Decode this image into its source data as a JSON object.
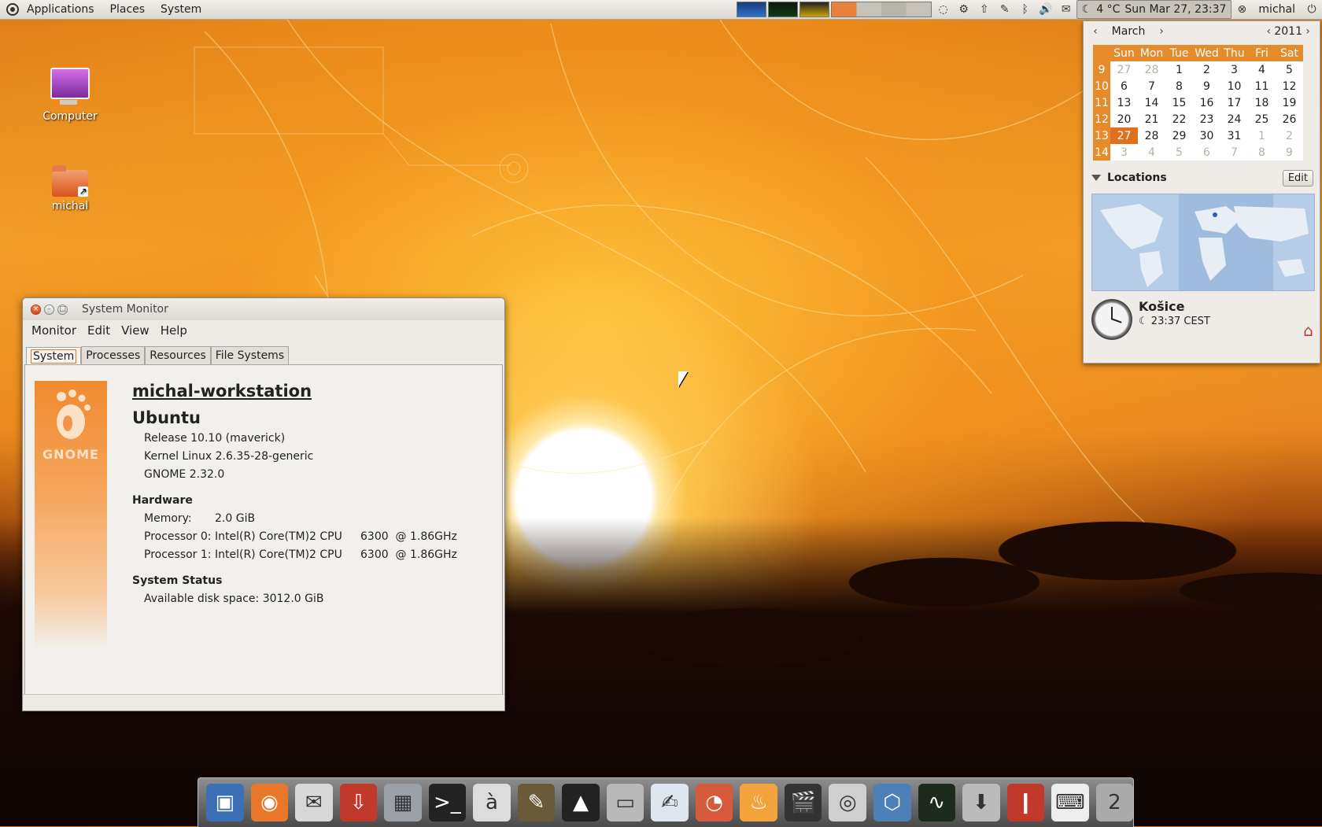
{
  "top_panel": {
    "menus": [
      "Applications",
      "Places",
      "System"
    ],
    "weather": "4 °C",
    "datetime": "Sun Mar 27, 23:37",
    "user": "michal",
    "tray_icons": [
      "network-icon",
      "update-icon",
      "upload-icon",
      "notes-icon",
      "bluetooth-icon",
      "volume-icon",
      "mail-icon"
    ]
  },
  "desktop": {
    "icons": [
      {
        "label": "Computer",
        "icon": "computer-icon"
      },
      {
        "label": "michal",
        "icon": "home-folder-icon"
      }
    ]
  },
  "calendar": {
    "month": "March",
    "year": "2011",
    "weekdays": [
      "Sun",
      "Mon",
      "Tue",
      "Wed",
      "Thu",
      "Fri",
      "Sat"
    ],
    "weeks": [
      {
        "wk": "9",
        "days": [
          "27",
          "28",
          "1",
          "2",
          "3",
          "4",
          "5"
        ],
        "other": [
          0,
          1
        ]
      },
      {
        "wk": "10",
        "days": [
          "6",
          "7",
          "8",
          "9",
          "10",
          "11",
          "12"
        ],
        "other": []
      },
      {
        "wk": "11",
        "days": [
          "13",
          "14",
          "15",
          "16",
          "17",
          "18",
          "19"
        ],
        "other": []
      },
      {
        "wk": "12",
        "days": [
          "20",
          "21",
          "22",
          "23",
          "24",
          "25",
          "26"
        ],
        "other": []
      },
      {
        "wk": "13",
        "days": [
          "27",
          "28",
          "29",
          "30",
          "31",
          "1",
          "2"
        ],
        "other": [
          5,
          6
        ]
      },
      {
        "wk": "14",
        "days": [
          "3",
          "4",
          "5",
          "6",
          "7",
          "8",
          "9"
        ],
        "other": [
          0,
          1,
          2,
          3,
          4,
          5,
          6
        ]
      }
    ],
    "today_index": [
      4,
      0
    ],
    "locations_label": "Locations",
    "edit_label": "Edit",
    "city": "Košice",
    "city_time": "23:37 CEST"
  },
  "window": {
    "title": "System Monitor",
    "menu": [
      "Monitor",
      "Edit",
      "View",
      "Help"
    ],
    "tabs": [
      "System",
      "Processes",
      "Resources",
      "File Systems"
    ],
    "active_tab": "System",
    "gnome_logo_text": "GNOME",
    "hostname": "michal-workstation",
    "os": "Ubuntu",
    "release": "Release 10.10 (maverick)",
    "kernel": "Kernel Linux 2.6.35-28-generic",
    "gnome": "GNOME 2.32.0",
    "hardware_label": "Hardware",
    "memory_label": "Memory:",
    "memory_value": "2.0 GiB",
    "cpu0_label": "Processor 0:",
    "cpu0_model": "Intel(R) Core(TM)2 CPU",
    "cpu0_speed": "6300  @ 1.86GHz",
    "cpu1_label": "Processor 1:",
    "cpu1_model": "Intel(R) Core(TM)2 CPU",
    "cpu1_speed": "6300  @ 1.86GHz",
    "status_label": "System Status",
    "disk_label": "Available disk space:",
    "disk_value": "3012.0 GiB"
  },
  "dock": {
    "items": [
      {
        "name": "file-manager-icon",
        "glyph": "▣"
      },
      {
        "name": "firefox-icon",
        "glyph": "◉"
      },
      {
        "name": "mail-client-icon",
        "glyph": "✉"
      },
      {
        "name": "installer-icon",
        "glyph": "⇩"
      },
      {
        "name": "calculator-icon",
        "glyph": "▦"
      },
      {
        "name": "terminal-icon",
        "glyph": ">_"
      },
      {
        "name": "character-map-icon",
        "glyph": "à"
      },
      {
        "name": "gimp-icon",
        "glyph": "✎"
      },
      {
        "name": "inkscape-icon",
        "glyph": "▲"
      },
      {
        "name": "scanner-icon",
        "glyph": "▭"
      },
      {
        "name": "writer-icon",
        "glyph": "✍"
      },
      {
        "name": "impress-icon",
        "glyph": "◔"
      },
      {
        "name": "burner-icon",
        "glyph": "♨"
      },
      {
        "name": "video-editor-icon",
        "glyph": "🎬"
      },
      {
        "name": "audio-player-icon",
        "glyph": "◎"
      },
      {
        "name": "virtualbox-icon",
        "glyph": "⬡"
      },
      {
        "name": "system-monitor-icon",
        "glyph": "∿"
      },
      {
        "name": "downloads-icon",
        "glyph": "⬇"
      },
      {
        "name": "thermometer-icon",
        "glyph": "❙"
      },
      {
        "name": "keyboard-layout-icon",
        "glyph": "⌨"
      },
      {
        "name": "trash-icon",
        "glyph": "2"
      }
    ]
  },
  "colors": {
    "accent": "#e68b2c",
    "today": "#e0701c"
  }
}
